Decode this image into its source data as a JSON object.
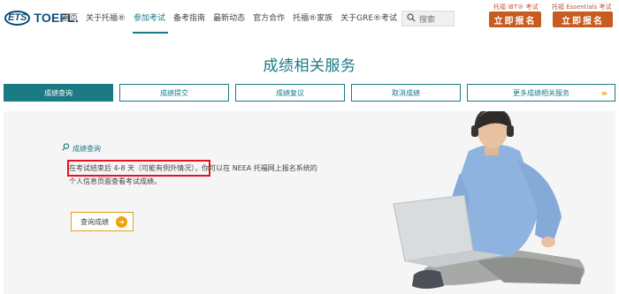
{
  "header": {
    "logo_ets": "ETS",
    "logo_toefl": "TOEFL.",
    "nav": [
      {
        "label": "首页"
      },
      {
        "label": "关于托福®"
      },
      {
        "label": "参加考试"
      },
      {
        "label": "备考指南"
      },
      {
        "label": "最新动态"
      },
      {
        "label": "官方合作"
      },
      {
        "label": "托福®家族"
      },
      {
        "label": "关于GRE®考试"
      }
    ],
    "search_placeholder": "搜索",
    "ibt_link": "托福 iBT® 考试",
    "essentials_link": "托福 Essentials 考试",
    "register_label": "立即报名"
  },
  "page_title": "成绩相关服务",
  "tabs": [
    {
      "label": "成绩查询"
    },
    {
      "label": "成绩提交"
    },
    {
      "label": "成绩复议"
    },
    {
      "label": "取消成绩"
    },
    {
      "label": "更多成绩相关服务"
    }
  ],
  "content": {
    "section_label": "成绩查询",
    "line1_highlight": "在考试结束后 4-8 天（可能有例外情况）",
    "line1_rest": "，你可以在 NEEA 托福网上报名系统的",
    "line2": "个人信息页面查看考试成绩。",
    "query_button": "查询成绩"
  },
  "colors": {
    "brand_teal": "#1a7a86",
    "register_orange": "#c75b20",
    "highlight_red": "#e3141b",
    "button_accent": "#f0a20a"
  }
}
